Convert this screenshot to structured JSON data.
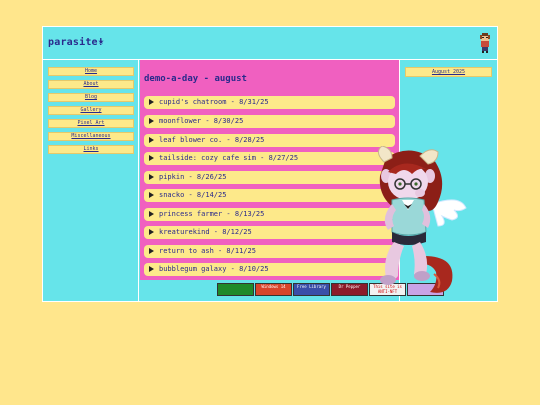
{
  "header": {
    "site_title": "parasite!",
    "star": "★",
    "mascot_icon": "pixel-character-icon"
  },
  "nav": {
    "items": [
      {
        "label": "Home"
      },
      {
        "label": "About"
      },
      {
        "label": "Blog"
      },
      {
        "label": "Gallery"
      },
      {
        "label": "Pixel Art"
      },
      {
        "label": "Miscellaneous"
      },
      {
        "label": "Links"
      }
    ]
  },
  "main": {
    "title": "demo-a-day - august",
    "entries": [
      {
        "label": "cupid's chatroom - 8/31/25"
      },
      {
        "label": "moonflower - 8/30/25"
      },
      {
        "label": "leaf blower co. - 8/28/25"
      },
      {
        "label": "tailside: cozy cafe sim - 8/27/25"
      },
      {
        "label": "pipkin - 8/26/25"
      },
      {
        "label": "snacko - 8/14/25"
      },
      {
        "label": "princess farmer - 8/13/25"
      },
      {
        "label": "kreaturekind - 8/12/25"
      },
      {
        "label": "return to ash - 8/11/25"
      },
      {
        "label": "bubblegum galaxy - 8/10/25"
      }
    ]
  },
  "sidebar_right": {
    "archive_label": "August 2025"
  },
  "badges": [
    {
      "text": "",
      "bg": "#1f8a2a",
      "fg": "#ffffff"
    },
    {
      "text": "Windows 14",
      "bg": "#d8442b",
      "fg": "#ffffff"
    },
    {
      "text": "Free Library",
      "bg": "#3a4fa8",
      "fg": "#ffffff"
    },
    {
      "text": "Dr Pepper",
      "bg": "#8c1b2a",
      "fg": "#ffffff"
    },
    {
      "text": "This site is ANTI-NFT",
      "bg": "#f2f2f2",
      "fg": "#cc0000"
    },
    {
      "text": "",
      "bg": "#c9a3e6",
      "fg": "#2a2a8c"
    }
  ],
  "colors": {
    "page_bg": "#ffe68c",
    "panel_bg": "#66e4ea",
    "main_bg": "#f060c0",
    "entry_bg": "#fde98a",
    "text": "#2a2a8c"
  }
}
